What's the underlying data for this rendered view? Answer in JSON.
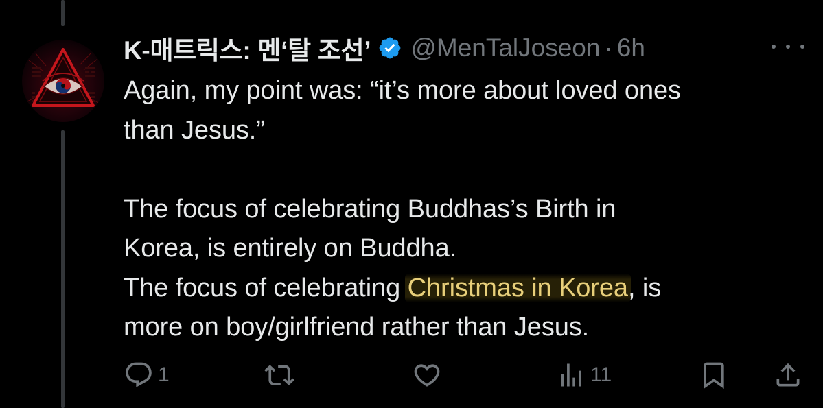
{
  "tweet": {
    "display_name": "K-매트릭스: 멘‘탈 조선’",
    "handle": "@MenTalJoseon",
    "separator": "·",
    "time": "6h",
    "verified": true,
    "body": {
      "line1": "Again, my point was: “it’s more about loved ones",
      "line2": "than Jesus.”",
      "para2_line1": "The focus of celebrating Buddhas’s Birth in",
      "para2_line2": "Korea, is entirely on Buddha.",
      "para3_prefix": "The focus of celebrating ",
      "para3_highlight": "Christmas in Korea",
      "para3_suffix": ", is",
      "para3_line2": "more on boy/girlfriend rather than Jesus."
    },
    "highlight_color": "#e8cf7a"
  },
  "actions": {
    "reply_icon": "reply-icon",
    "reply_count": "1",
    "retweet_icon": "retweet-icon",
    "like_icon": "heart-icon",
    "views_icon": "views-icon",
    "views_count": "11",
    "bookmark_icon": "bookmark-icon",
    "share_icon": "share-icon"
  },
  "colors": {
    "background": "#000000",
    "text": "#e7e9ea",
    "secondary": "#71767b",
    "verified": "#1d9bf0"
  }
}
